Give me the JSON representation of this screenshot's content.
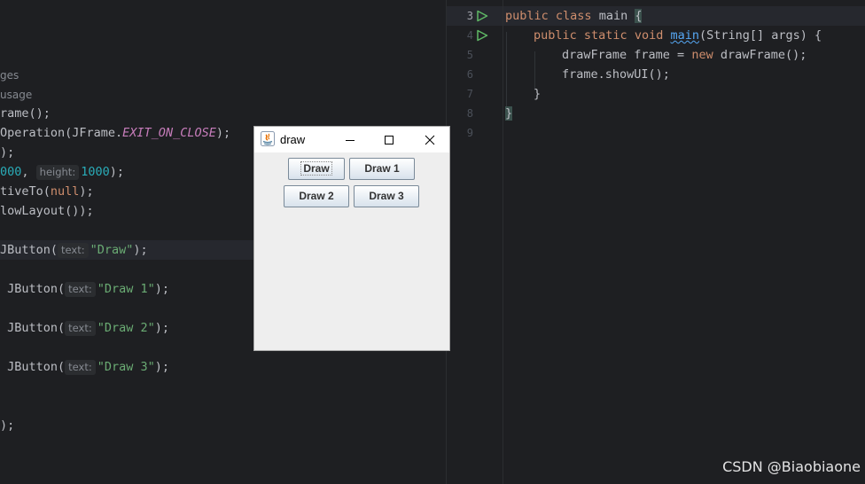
{
  "left_editor": {
    "usages_line": "ges",
    "usage_line": "usage",
    "lines": [
      {
        "t1": "rame();"
      },
      {
        "t1": "Operation(JFrame.",
        "const": "EXIT_ON_CLOSE",
        "t2": ");"
      },
      {
        "t1": ");"
      },
      {
        "num1": "000",
        "sep": ", ",
        "hint": "height:",
        "num2": "1000",
        "t2": ");"
      },
      {
        "t1": "tiveTo(",
        "kw": "null",
        "t2": ");"
      },
      {
        "t1": "lowLayout());"
      },
      {
        "t1": "JButton(",
        "hint": "text:",
        "str": "\"Draw\"",
        "t2": ");"
      },
      {
        "t1": " JButton(",
        "hint": "text:",
        "str": "\"Draw 1\"",
        "t2": ");"
      },
      {
        "t1": " JButton(",
        "hint": "text:",
        "str": "\"Draw 2\"",
        "t2": ");"
      },
      {
        "t1": " JButton(",
        "hint": "text:",
        "str": "\"Draw 3\"",
        "t2": ");"
      },
      {
        "t1": ");"
      }
    ]
  },
  "right_editor": {
    "line_numbers": [
      "3",
      "4",
      "5",
      "6",
      "7",
      "8",
      "9"
    ],
    "line3": {
      "kw1": "public",
      "kw2": "class",
      "name": " main ",
      "brace": "{"
    },
    "line4": {
      "kw1": "public",
      "kw2": "static",
      "kw3": "void",
      "fn": "main",
      "rest": "(String[] args) {"
    },
    "line5": {
      "t1": "drawFrame frame = ",
      "kw": "new",
      "t2": " drawFrame();"
    },
    "line6": {
      "t1": "frame.showUI();"
    },
    "line7": {
      "t1": "}"
    },
    "line8": {
      "t1": "}"
    }
  },
  "swing_window": {
    "title": "draw",
    "buttons": [
      "Draw",
      "Draw 1",
      "Draw 2",
      "Draw 3"
    ]
  },
  "colors": {
    "editor_bg": "#1e1f22",
    "keyword": "#cf8e6d",
    "string": "#6aab73",
    "number": "#2aacb8",
    "constant": "#c77dbb",
    "function": "#56a8f5"
  },
  "icons": [
    "run-icon",
    "java-app-icon",
    "minimize-icon",
    "maximize-icon",
    "close-icon"
  ],
  "watermark": "CSDN @Biaobiaone"
}
